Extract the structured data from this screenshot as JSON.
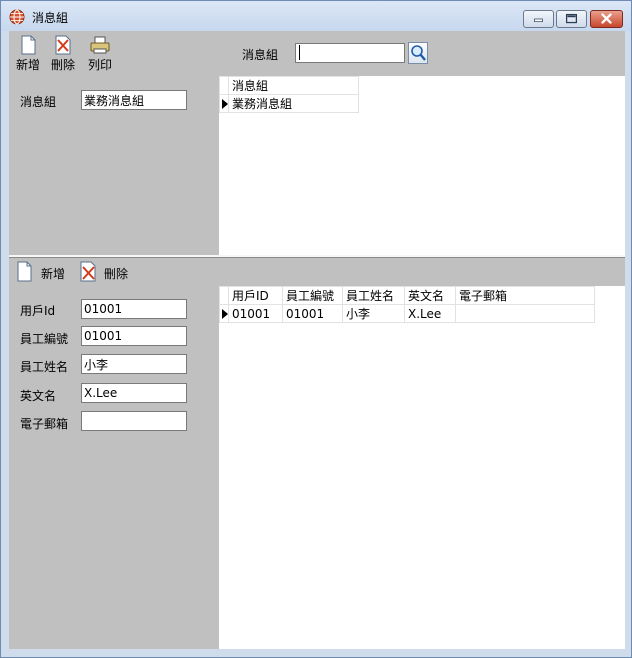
{
  "window": {
    "title": "消息組",
    "colors": {
      "title_bar": "#c7d7ee",
      "panel": "#c0c0c0",
      "close_button": "#c8452d"
    }
  },
  "toolbar_top": {
    "add_label": "新增",
    "delete_label": "刪除",
    "print_label": "列印",
    "search_label": "消息組",
    "search_value": ""
  },
  "group_form": {
    "label": "消息組",
    "value": "業務消息組"
  },
  "group_grid": {
    "columns": [
      "消息組"
    ],
    "rows": [
      [
        "業務消息組"
      ]
    ]
  },
  "toolbar_detail": {
    "add_label": "新增",
    "delete_label": "刪除"
  },
  "member_form": {
    "fields": [
      {
        "label": "用戶Id",
        "value": "01001"
      },
      {
        "label": "員工編號",
        "value": "01001"
      },
      {
        "label": "員工姓名",
        "value": "小李"
      },
      {
        "label": "英文名",
        "value": "X.Lee"
      },
      {
        "label": "電子郵箱",
        "value": ""
      }
    ]
  },
  "member_grid": {
    "columns": [
      "用戶ID",
      "員工編號",
      "員工姓名",
      "英文名",
      "電子郵箱"
    ],
    "rows": [
      [
        "01001",
        "01001",
        "小李",
        "X.Lee",
        ""
      ]
    ]
  }
}
